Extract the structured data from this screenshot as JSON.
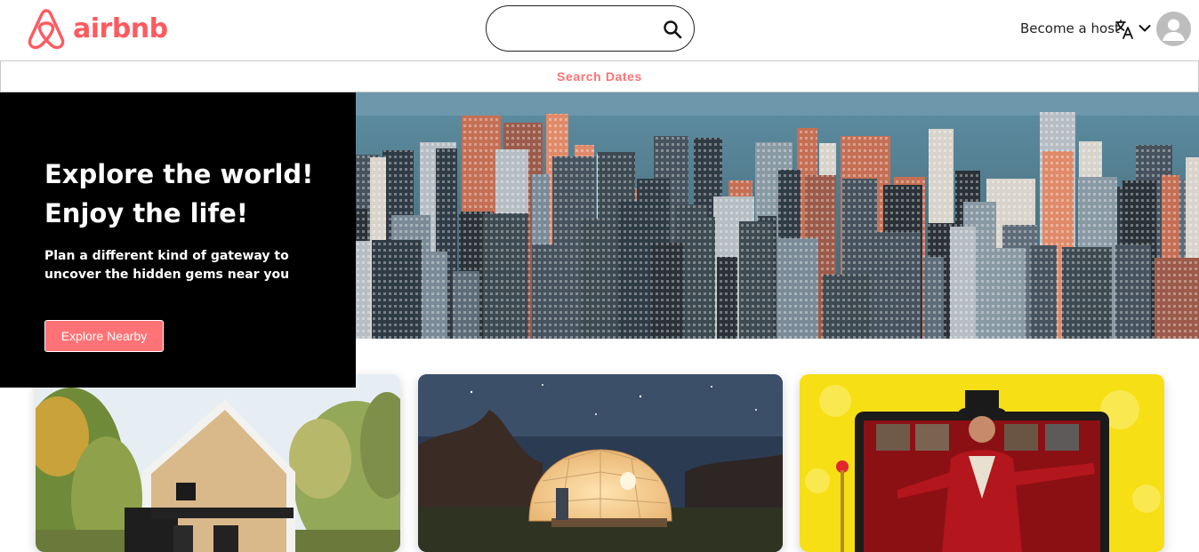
{
  "brand": {
    "name": "airbnb",
    "color": "#ff5a5f"
  },
  "search": {
    "placeholder": "",
    "value": "",
    "icon": "search-icon"
  },
  "nav": {
    "host_label": "Become a host",
    "language_icon": "translate-icon",
    "menu_icon": "chevron-down-icon",
    "profile_icon": "user-avatar-icon"
  },
  "dates_bar": {
    "label": "Search Dates",
    "color": "#ff7275"
  },
  "hero": {
    "title_line1": "Explore the world!",
    "title_line2": "Enjoy the life!",
    "subtitle_line1": "Plan a different kind of gateway to",
    "subtitle_line2": "uncover the hidden gems near you",
    "button_label": "Explore Nearby",
    "button_color": "#ff7275"
  },
  "cards": [
    {
      "image": "wooden-cabin-in-forest"
    },
    {
      "image": "glowing-dome-tent-under-night-sky"
    },
    {
      "image": "ringmaster-online-experience"
    }
  ]
}
